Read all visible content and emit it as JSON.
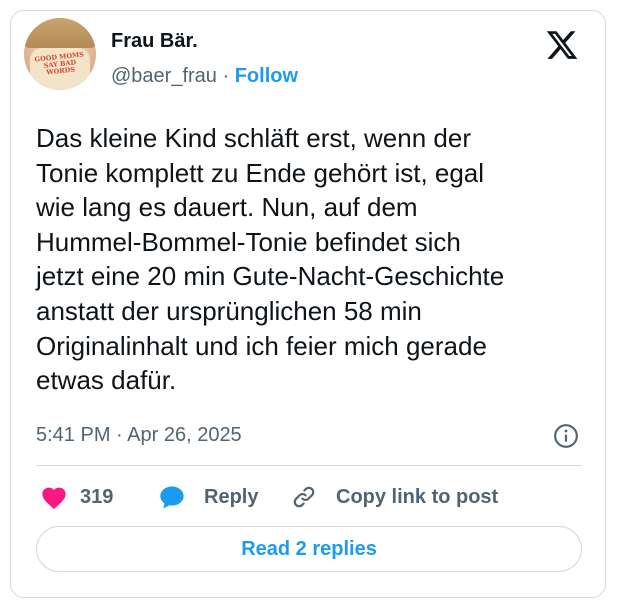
{
  "author": {
    "name": "Frau Bär.",
    "handle": "@baer_frau",
    "separator": "·",
    "follow_label": "Follow",
    "avatar_shirt_text": "GOOD MOMS SAY BAD WORDS"
  },
  "tweet": {
    "text": "Das kleine Kind schläft erst, wenn der\nTonie komplett zu Ende gehört ist, egal\nwie lang es dauert. Nun, auf dem\nHummel-Bommel-Tonie befindet sich\njetzt eine 20 min Gute-Nacht-Geschichte\nanstatt der ursprünglichen 58 min\nOriginalinhalt und ich feier mich gerade\netwas dafür.",
    "timestamp": "5:41 PM · Apr 26, 2025"
  },
  "actions": {
    "like_count": "319",
    "reply_label": "Reply",
    "copy_label": "Copy link to post",
    "read_replies_label": "Read 2 replies"
  },
  "icons": {
    "logo": "x-logo-icon",
    "info": "info-icon",
    "like": "heart-icon",
    "reply": "speech-bubble-icon",
    "copy": "link-icon"
  },
  "colors": {
    "accent": "#1d9bf0",
    "like": "#f91880",
    "secondary_text": "#536471",
    "border": "#cfd9de"
  }
}
